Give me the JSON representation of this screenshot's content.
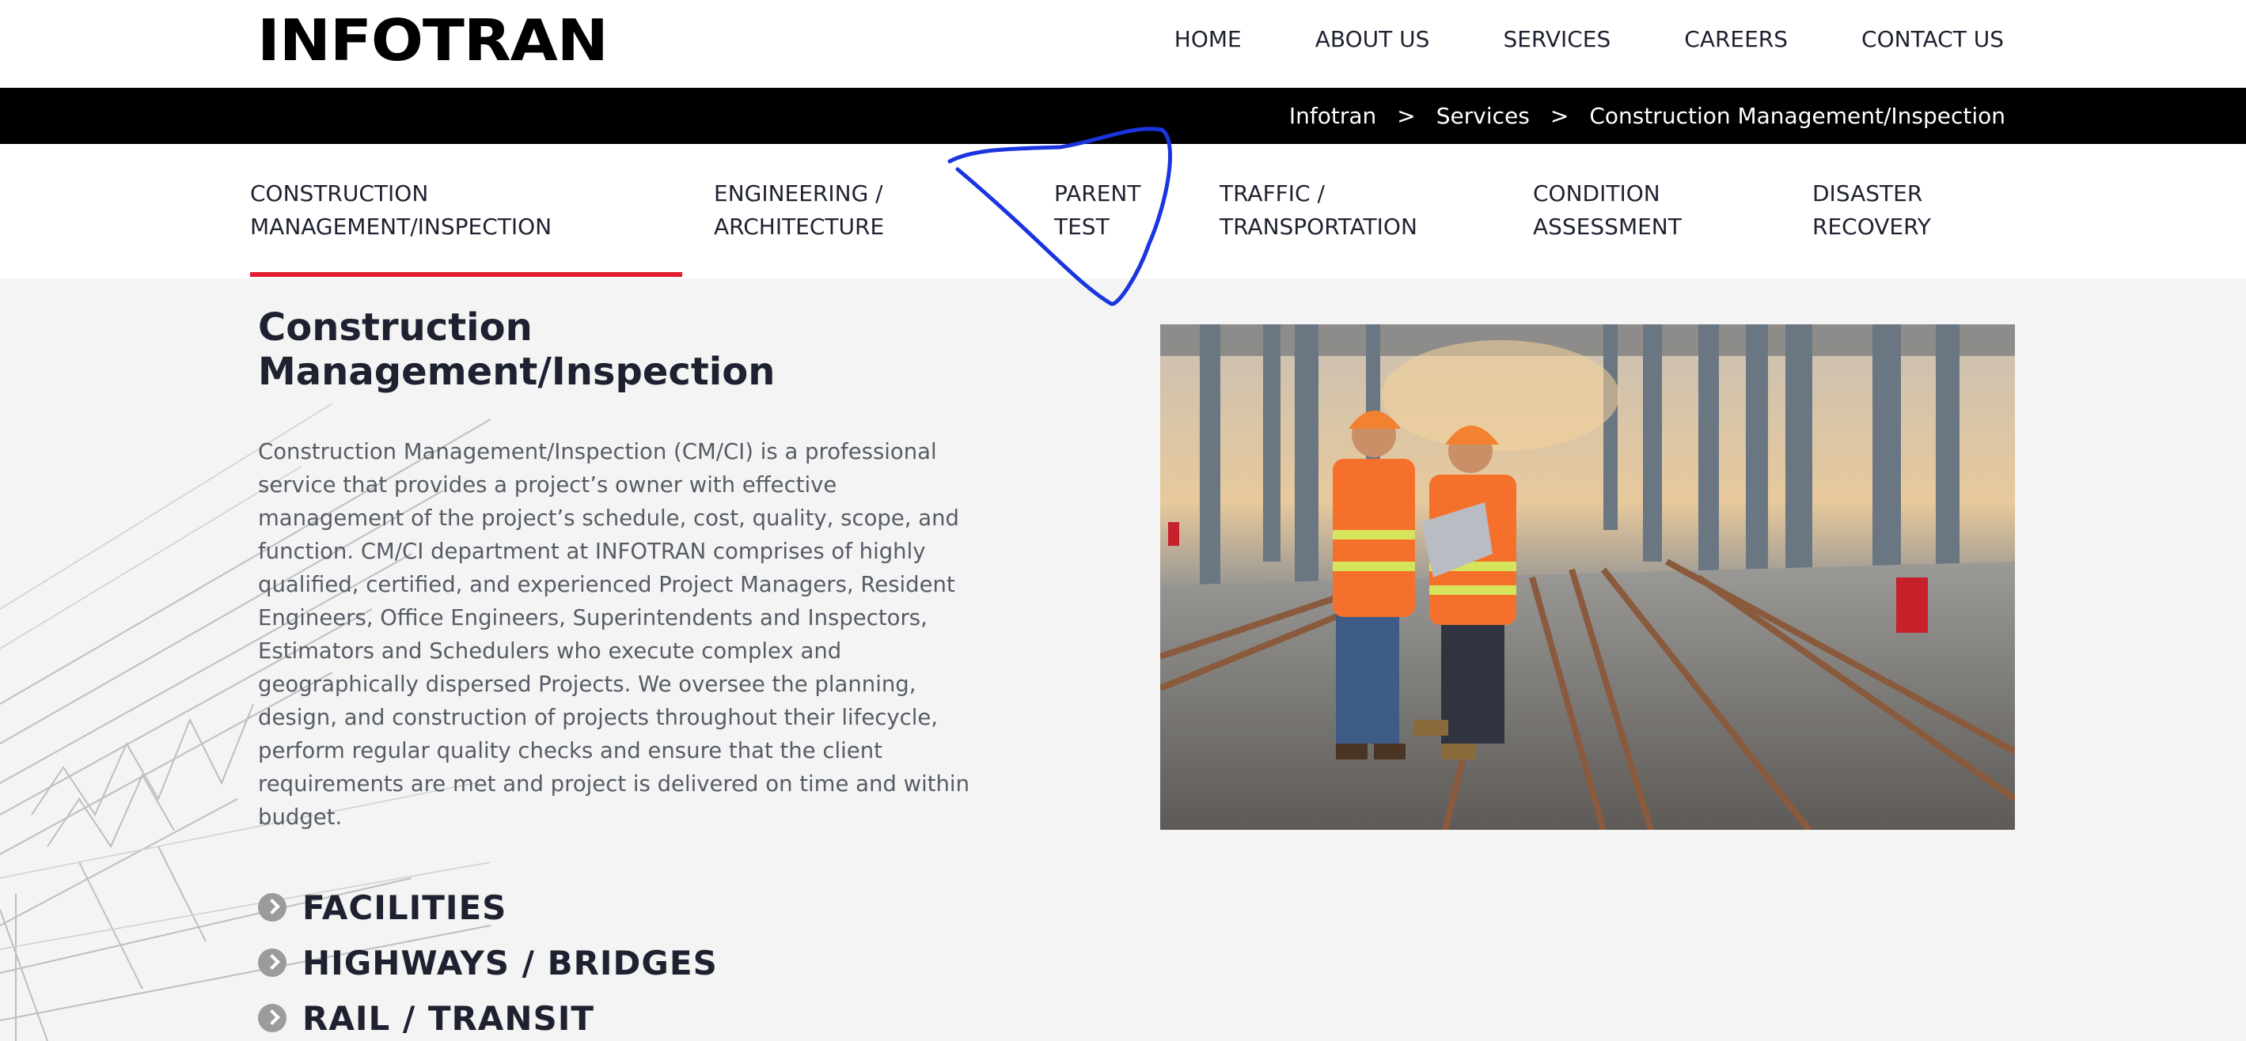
{
  "brand": {
    "logo_text": "INFOTRAN",
    "accent_blue": "#1d2f8a",
    "accent_red": "#d41f2b"
  },
  "nav": {
    "items": [
      {
        "label": "HOME"
      },
      {
        "label": "ABOUT US"
      },
      {
        "label": "SERVICES"
      },
      {
        "label": "CAREERS"
      },
      {
        "label": "CONTACT US"
      }
    ]
  },
  "breadcrumb": {
    "items": [
      "Infotran",
      "Services",
      "Construction Management/Inspection"
    ],
    "separator": ">"
  },
  "tabs": [
    {
      "lines": [
        "CONSTRUCTION",
        "MANAGEMENT/INSPECTION"
      ],
      "active": true
    },
    {
      "lines": [
        "ENGINEERING /",
        "ARCHITECTURE"
      ],
      "active": false
    },
    {
      "lines": [
        "PARENT",
        "TEST"
      ],
      "active": false
    },
    {
      "lines": [
        "TRAFFIC /",
        "TRANSPORTATION"
      ],
      "active": false
    },
    {
      "lines": [
        "CONDITION",
        "ASSESSMENT"
      ],
      "active": false
    },
    {
      "lines": [
        "DISASTER",
        "RECOVERY"
      ],
      "active": false
    }
  ],
  "active_tab_color": "#e11d2e",
  "content": {
    "title_lines": [
      "Construction",
      "Management/Inspection"
    ],
    "description_lines": [
      "Construction Management/Inspection (CM/CI) is a professional",
      "service that provides a project’s owner with effective",
      "management of the project’s schedule, cost, quality, scope, and",
      "function. CM/CI department at INFOTRAN comprises of highly",
      "qualified, certified, and experienced Project Managers, Resident",
      "Engineers, Office Engineers, Superintendents and Inspectors,",
      "Estimators and Schedulers who execute complex and",
      "geographically dispersed Projects. We oversee the planning,",
      "design, and construction of projects throughout their lifecycle,",
      "perform regular quality checks and ensure that the client",
      "requirements are met and project is delivered on time and within",
      "budget."
    ],
    "categories": [
      {
        "label": "FACILITIES",
        "icon": "chevron-right-circle-icon"
      },
      {
        "label": "HIGHWAYS / BRIDGES",
        "icon": "chevron-right-circle-icon"
      },
      {
        "label": "RAIL / TRANSIT",
        "icon": "chevron-right-circle-icon"
      }
    ]
  },
  "photo": {
    "subject": "two-workers-on-rail-tracks-photo"
  },
  "annotation": {
    "color": "#1a35e0"
  }
}
